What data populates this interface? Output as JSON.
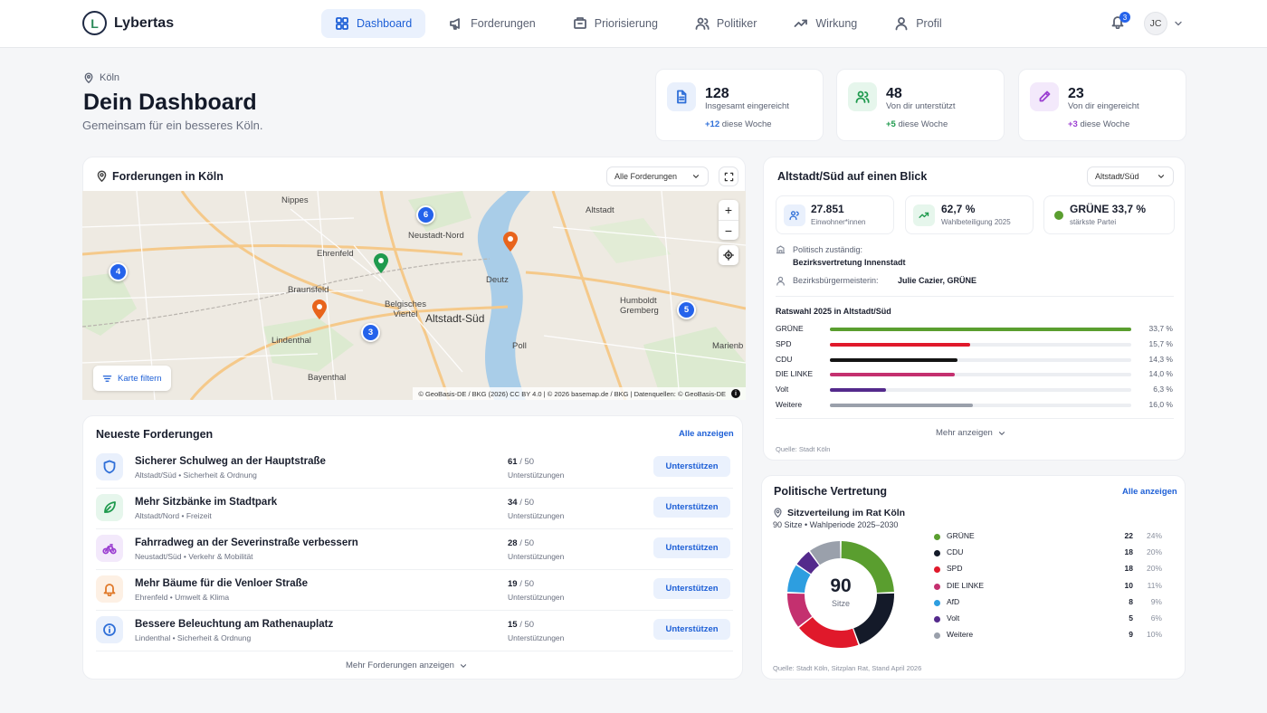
{
  "brand": {
    "name": "Lybertas",
    "mark": "L"
  },
  "nav": [
    {
      "label": "Dashboard",
      "icon": "grid-icon",
      "active": true
    },
    {
      "label": "Forderungen",
      "icon": "megaphone-icon"
    },
    {
      "label": "Priorisierung",
      "icon": "vote-box-icon"
    },
    {
      "label": "Politiker",
      "icon": "users-icon"
    },
    {
      "label": "Wirkung",
      "icon": "trend-up-icon"
    },
    {
      "label": "Profil",
      "icon": "user-icon"
    }
  ],
  "user": {
    "notifications": "3",
    "initials": "JC"
  },
  "header": {
    "location": "Köln",
    "title": "Dein Dashboard",
    "subtitle": "Gemeinsam für ein besseres Köln."
  },
  "stats": [
    {
      "value": "128",
      "label": "Insgesamt eingereicht",
      "delta": "+12",
      "delta_text": "diese Woche",
      "color": "#2f6fd8",
      "bg": "#e9f0fc"
    },
    {
      "value": "48",
      "label": "Von dir unterstützt",
      "delta": "+5",
      "delta_text": "diese Woche",
      "color": "#1f9a4e",
      "bg": "#e6f6ec"
    },
    {
      "value": "23",
      "label": "Von dir eingereicht",
      "delta": "+3",
      "delta_text": "diese Woche",
      "color": "#9b3fd1",
      "bg": "#f3e9fb"
    }
  ],
  "map_card": {
    "title": "Forderungen in Köln",
    "filter_select": "Alle Forderungen",
    "filter_button": "Karte filtern",
    "attribution": "© GeoBasis-DE / BKG (2026) CC BY 4.0 | © 2026 basemap.de / BKG | Datenquellen: © GeoBasis-DE",
    "labels": [
      "Nippes",
      "Ehrenfeld",
      "Neustadt-Nord",
      "Altstadt",
      "Braunsfeld",
      "Belgisches Viertel",
      "Altstadt-Süd",
      "Deutz",
      "Humboldt Gremberg",
      "Lindenthal",
      "Bayenthal",
      "Poll",
      "Marienb"
    ],
    "clusters": [
      "6",
      "4",
      "3",
      "5"
    ]
  },
  "demands": {
    "title": "Neueste Forderungen",
    "all_link": "Alle anzeigen",
    "support_label": "Unterstützungen",
    "button_label": "Unterstützen",
    "more": "Mehr Forderungen anzeigen",
    "items": [
      {
        "title": "Sicherer Schulweg an der Hauptstraße",
        "meta": "Altstadt/Süd • Sicherheit & Ordnung",
        "count": "61",
        "of": "/ 50",
        "icon": "shield-icon",
        "color": "#2f6fd8",
        "bg": "#e9f0fc"
      },
      {
        "title": "Mehr Sitzbänke im Stadtpark",
        "meta": "Altstadt/Nord • Freizeit",
        "count": "34",
        "of": "/ 50",
        "icon": "leaf-icon",
        "color": "#1f9a4e",
        "bg": "#e6f6ec"
      },
      {
        "title": "Fahrradweg an der Severinstraße verbessern",
        "meta": "Neustadt/Süd • Verkehr & Mobilität",
        "count": "28",
        "of": "/ 50",
        "icon": "bike-icon",
        "color": "#9b3fd1",
        "bg": "#f3e9fb"
      },
      {
        "title": "Mehr Bäume für die Venloer Straße",
        "meta": "Ehrenfeld • Umwelt & Klima",
        "count": "19",
        "of": "/ 50",
        "icon": "bell-icon",
        "color": "#e0792a",
        "bg": "#fdf0e4"
      },
      {
        "title": "Bessere Beleuchtung am Rathenauplatz",
        "meta": "Lindenthal • Sicherheit & Ordnung",
        "count": "15",
        "of": "/ 50",
        "icon": "info-icon",
        "color": "#2f6fd8",
        "bg": "#e9f0fc"
      }
    ]
  },
  "district": {
    "title": "Altstadt/Süd auf einen Blick",
    "select": "Altstadt/Süd",
    "kpis": [
      {
        "value": "27.851",
        "label": "Einwohner*innen"
      },
      {
        "value": "62,7 %",
        "label": "Wahlbeteiligung 2025"
      },
      {
        "value": "GRÜNE 33,7 %",
        "label": "stärkste Partei"
      }
    ],
    "responsible_label": "Politisch zuständig:",
    "responsible_value": "Bezirksvertretung Innenstadt",
    "mayor_label": "Bezirksbürgermeisterin:",
    "mayor_value": "Julie Cazier, GRÜNE",
    "election_title": "Ratswahl 2025 in Altstadt/Süd",
    "more": "Mehr anzeigen",
    "source": "Quelle: Stadt Köln"
  },
  "representation": {
    "title": "Politische Vertretung",
    "all_link": "Alle anzeigen",
    "subtitle": "Sitzverteilung im Rat Köln",
    "seats_meta": "90 Sitze • Wahlperiode 2025–2030",
    "total": "90",
    "total_label": "Sitze",
    "source": "Quelle: Stadt Köln, Sitzplan Rat, Stand April 2026"
  },
  "chart_data": [
    {
      "type": "bar",
      "title": "Ratswahl 2025 in Altstadt/Süd",
      "categories": [
        "GRÜNE",
        "SPD",
        "CDU",
        "DIE LINKE",
        "Volt",
        "Weitere"
      ],
      "values": [
        33.7,
        15.7,
        14.3,
        14.0,
        6.3,
        16.0
      ],
      "labels": [
        "33,7 %",
        "15,7 %",
        "14,3 %",
        "14,0 %",
        "6,3 %",
        "16,0 %"
      ],
      "colors": [
        "#5a9e2f",
        "#e0192b",
        "#141414",
        "#c4306f",
        "#542a8c",
        "#9aa0ab"
      ],
      "xlim": [
        0,
        33.7
      ]
    },
    {
      "type": "pie",
      "title": "Sitzverteilung im Rat Köln",
      "categories": [
        "GRÜNE",
        "CDU",
        "SPD",
        "DIE LINKE",
        "AfD",
        "Volt",
        "Weitere"
      ],
      "values": [
        22,
        18,
        18,
        10,
        8,
        5,
        9
      ],
      "percent_labels": [
        "24%",
        "20%",
        "20%",
        "11%",
        "9%",
        "6%",
        "10%"
      ],
      "colors": [
        "#5a9e2f",
        "#141a29",
        "#e0192b",
        "#c4306f",
        "#2d9ee0",
        "#542a8c",
        "#9aa0ab"
      ]
    }
  ]
}
